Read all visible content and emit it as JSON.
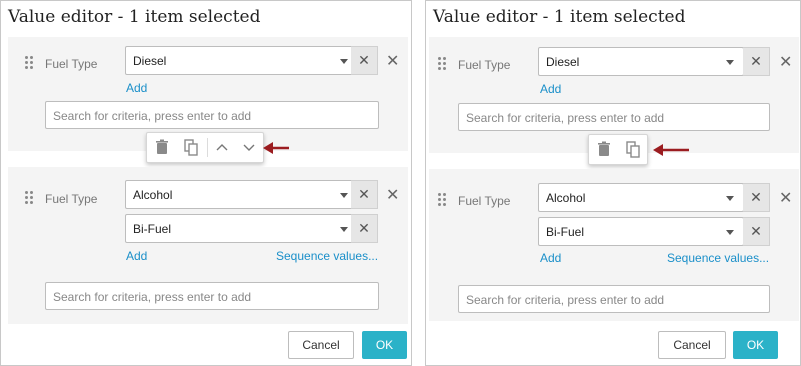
{
  "left": {
    "title": "Value editor - 1 item selected",
    "group1": {
      "label": "Fuel Type",
      "values": [
        "Diesel"
      ],
      "add_link": "Add",
      "search_placeholder": "Search for criteria, press enter to add"
    },
    "toolbar": {
      "icons": [
        "trash-icon",
        "copy-icon",
        "chevron-up-icon",
        "chevron-down-icon"
      ]
    },
    "group2": {
      "label": "Fuel Type",
      "values": [
        "Alcohol",
        "Bi-Fuel"
      ],
      "add_link": "Add",
      "sequence_link": "Sequence values...",
      "search_placeholder": "Search for criteria, press enter to add"
    },
    "cancel_label": "Cancel",
    "ok_label": "OK"
  },
  "right": {
    "title": "Value editor - 1 item selected",
    "group1": {
      "label": "Fuel Type",
      "values": [
        "Diesel"
      ],
      "add_link": "Add",
      "search_placeholder": "Search for criteria, press enter to add"
    },
    "toolbar": {
      "icons": [
        "trash-icon",
        "copy-icon"
      ]
    },
    "group2": {
      "label": "Fuel Type",
      "values": [
        "Alcohol",
        "Bi-Fuel"
      ],
      "add_link": "Add",
      "sequence_link": "Sequence values...",
      "search_placeholder": "Search for criteria, press enter to add"
    },
    "cancel_label": "Cancel",
    "ok_label": "OK"
  },
  "colors": {
    "link": "#1a8fc9",
    "ok": "#2bb2c8",
    "arrow": "#9b1c20",
    "group_bg": "#f4f4f4"
  },
  "clear_glyph": "✕",
  "remove_glyph": "✕"
}
